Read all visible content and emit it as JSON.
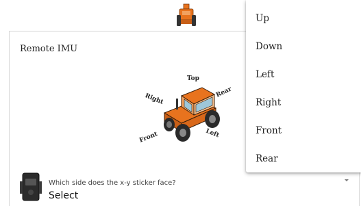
{
  "app": {
    "logo_icon": "tractor-logo-icon",
    "accent_color": "#e8731e"
  },
  "section": {
    "title": "Remote IMU"
  },
  "diagram": {
    "icon": "tractor-orientation-icon",
    "labels": {
      "top": "Top",
      "right": "Right",
      "rear": "Rear",
      "front": "Front",
      "left": "Left"
    }
  },
  "orientation_select": {
    "device_icon": "imu-device-icon",
    "question": "Which side does the x-y sticker face?",
    "value": "Select",
    "options": [
      "Up",
      "Down",
      "Left",
      "Right",
      "Front",
      "Rear"
    ]
  }
}
